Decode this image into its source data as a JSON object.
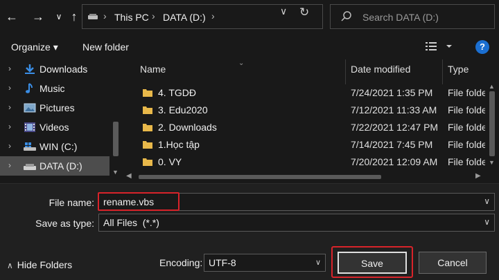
{
  "address_bar": {
    "back_icon": "arrow-left-icon",
    "forward_icon": "arrow-right-icon",
    "recent_icon": "chevron-down-icon",
    "up_icon": "arrow-up-icon",
    "crumbs": [
      "This PC",
      "DATA (D:)"
    ],
    "refresh_icon": "refresh-icon"
  },
  "search": {
    "placeholder": "Search DATA (D:)"
  },
  "toolbar": {
    "organize_label": "Organize ▾",
    "new_folder_label": "New folder",
    "help_label": "?"
  },
  "nav_pane": {
    "items": [
      {
        "label": "Downloads",
        "icon": "download-arrow-icon"
      },
      {
        "label": "Music",
        "icon": "music-note-icon"
      },
      {
        "label": "Pictures",
        "icon": "pictures-icon"
      },
      {
        "label": "Videos",
        "icon": "film-strip-icon"
      },
      {
        "label": "WIN (C:)",
        "icon": "windows-drive-icon"
      },
      {
        "label": "DATA (D:)",
        "icon": "drive-icon",
        "selected": true
      }
    ]
  },
  "file_list": {
    "columns": {
      "name": "Name",
      "date": "Date modified",
      "type": "Type"
    },
    "rows": [
      {
        "name": "4. TGDĐ",
        "date": "7/24/2021 1:35 PM",
        "type": "File folder"
      },
      {
        "name": "3. Edu2020",
        "date": "7/12/2021 11:33 AM",
        "type": "File folder"
      },
      {
        "name": "2. Downloads",
        "date": "7/22/2021 12:47 PM",
        "type": "File folder"
      },
      {
        "name": "1.Học tập",
        "date": "7/14/2021 7:45 PM",
        "type": "File folder"
      },
      {
        "name": "0. VY",
        "date": "7/20/2021 12:09 AM",
        "type": "File folder"
      }
    ]
  },
  "save_form": {
    "file_name_label": "File name:",
    "file_name_value": "rename.vbs",
    "save_type_label": "Save as type:",
    "save_type_value": "All Files  (*.*)",
    "encoding_label": "Encoding:",
    "encoding_value": "UTF-8",
    "hide_folders_label": "Hide Folders",
    "save_label": "Save",
    "cancel_label": "Cancel"
  },
  "colors": {
    "background": "#191919",
    "bottom_panel": "#202020",
    "highlight": "#d9232a",
    "folder": "#e8b84a",
    "accent": "#1b6fd1"
  }
}
